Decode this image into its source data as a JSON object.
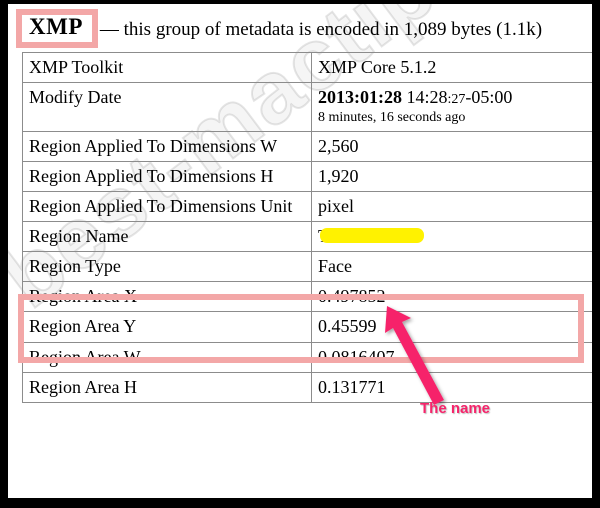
{
  "header": {
    "group_label": "XMP",
    "description": "— this group of metadata is encoded in 1,089 bytes (1.1k)"
  },
  "watermark": {
    "text": "best-mactips.com"
  },
  "table": {
    "rows": [
      {
        "key": "XMP Toolkit",
        "value": "XMP Core 5.1.2"
      },
      {
        "key": "Modify Date",
        "value_date": "2013:01:28",
        "value_time": " 14:28",
        "value_secs": ":27",
        "value_offset": "-05:00",
        "value_sub": "8 minutes, 16 seconds ago"
      },
      {
        "key": "Region Applied To Dimensions W",
        "value": "2,560"
      },
      {
        "key": "Region Applied To Dimensions H",
        "value": "1,920"
      },
      {
        "key": "Region Applied To Dimensions Unit",
        "value": "pixel"
      },
      {
        "key": "Region Name",
        "value": "T"
      },
      {
        "key": "Region Type",
        "value": "Face"
      },
      {
        "key": "Region Area X",
        "value": "0.497852"
      },
      {
        "key": "Region Area Y",
        "value": "0.45599"
      },
      {
        "key": "Region Area W",
        "value": "0.0816407"
      },
      {
        "key": "Region Area H",
        "value": "0.131771"
      }
    ]
  },
  "annotation": {
    "label": "The name"
  },
  "colors": {
    "callout_pink": "#f3a7a7",
    "arrow_pink": "#f6246b",
    "redaction_yellow": "#fff200",
    "grid_line": "#8c8c8c"
  }
}
